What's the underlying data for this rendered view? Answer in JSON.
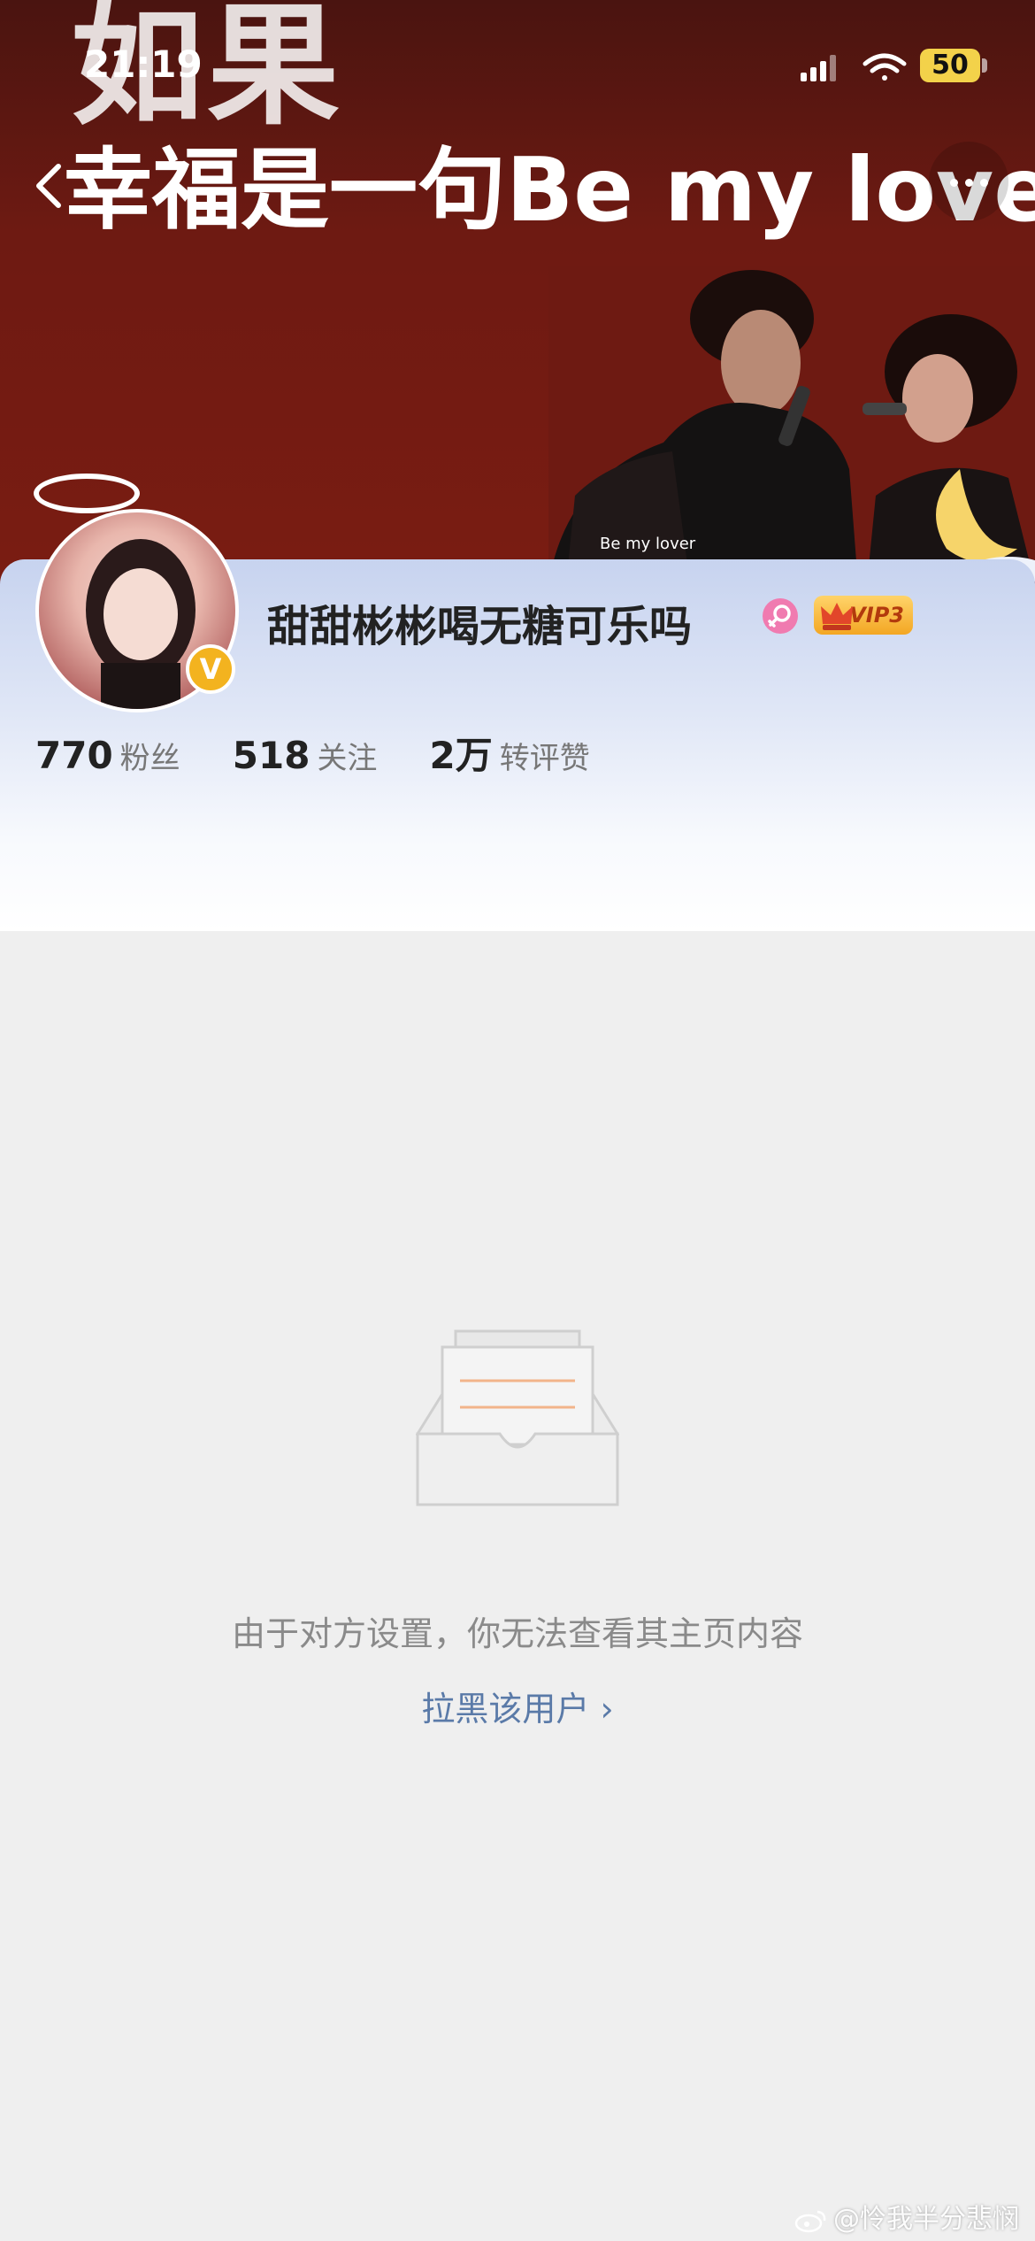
{
  "status_bar": {
    "time": "21:19",
    "battery": "50"
  },
  "banner": {
    "line1": "如果",
    "line2": "幸福是一句Be my lover",
    "photo_subtitle": "Be my lover"
  },
  "profile": {
    "username": "甜甜彬彬喝无糖可乐吗",
    "vip_label": "VIP3",
    "verified_mark": "V",
    "stats": [
      {
        "value": "770",
        "label": "粉丝"
      },
      {
        "value": "518",
        "label": "关注"
      },
      {
        "value": "2万",
        "label": "转评赞"
      }
    ]
  },
  "empty_state": {
    "message": "由于对方设置，你无法查看其主页内容",
    "link_label": "拉黑该用户 ›"
  },
  "watermark": "@怜我半分悲悯",
  "icons": {
    "back": "chevron-left-icon",
    "more": "more-dots-icon",
    "signal": "signal-icon",
    "wifi": "wifi-icon",
    "gender": "female-icon",
    "vip": "crown-icon",
    "empty": "empty-tray-icon",
    "weibo": "weibo-logo-icon"
  },
  "colors": {
    "banner": "#6e1a12",
    "link": "#5a7aa8",
    "vip_gold": "#f3a623",
    "verified": "#f3b31f",
    "gender_pink": "#f07bb0"
  }
}
